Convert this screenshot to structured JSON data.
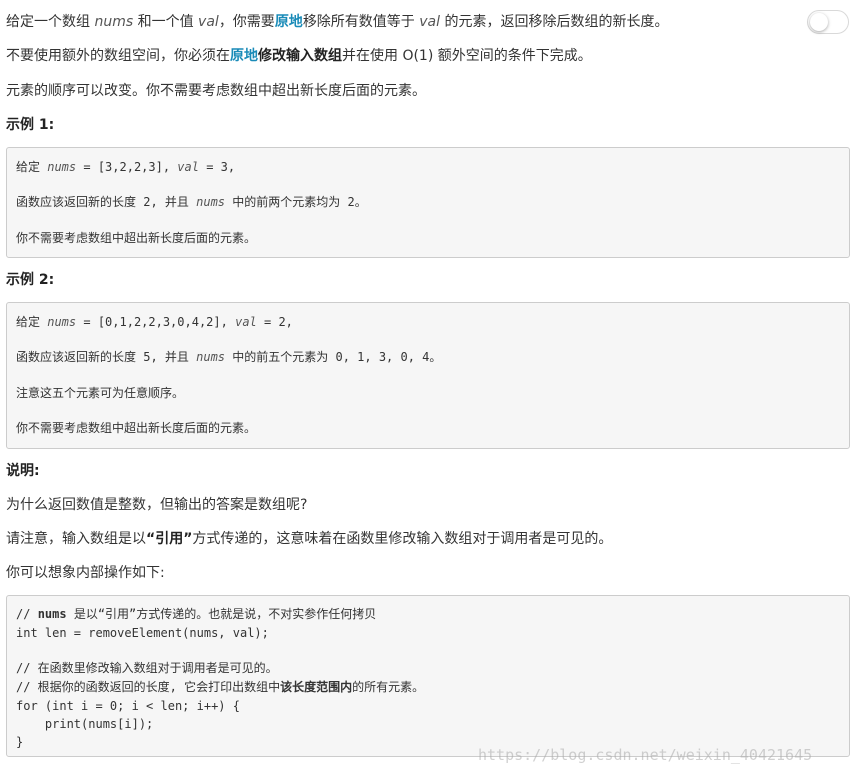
{
  "intro": {
    "p1": {
      "a": "给定一个数组 ",
      "nums": "nums",
      "b": " 和一个值 ",
      "val": "val",
      "c": "，你需要",
      "inplace": "原地",
      "d": "移除所有数值等于 ",
      "val2": "val",
      "e": " 的元素，返回移除后数组的新长度。"
    },
    "p2": {
      "a": "不要使用额外的数组空间，你必须在",
      "inplace": "原地",
      "modify": "修改输入数组",
      "b": "并在使用 O(1) 额外空间的条件下完成。"
    },
    "p3": "元素的顺序可以改变。你不需要考虑数组中超出新长度后面的元素。"
  },
  "example1": {
    "heading": "示例 1:",
    "line1": {
      "a": "给定 ",
      "nums": "nums",
      "b": " = [3,2,2,3], ",
      "val": "val",
      "c": " = 3,"
    },
    "line2": {
      "a": "函数应该返回新的长度 2, 并且 ",
      "nums": "nums",
      "b": " 中的前两个元素均为 2。"
    },
    "line3": "你不需要考虑数组中超出新长度后面的元素。"
  },
  "example2": {
    "heading": "示例 2:",
    "line1": {
      "a": "给定 ",
      "nums": "nums",
      "b": " = [0,1,2,2,3,0,4,2], ",
      "val": "val",
      "c": " = 2,"
    },
    "line2": {
      "a": "函数应该返回新的长度 5, 并且 ",
      "nums": "nums",
      "b": " 中的前五个元素为 0, 1, 3, 0, 4。"
    },
    "line3": "注意这五个元素可为任意顺序。",
    "line4": "你不需要考虑数组中超出新长度后面的元素。"
  },
  "explain": {
    "heading": "说明:",
    "p1": "为什么返回数值是整数，但输出的答案是数组呢?",
    "p2": {
      "a": "请注意，输入数组是以",
      "ref": "“引用”",
      "b": "方式传递的，这意味着在函数里修改输入数组对于调用者是可见的。"
    },
    "p3": "你可以想象内部操作如下:"
  },
  "code": {
    "c1": {
      "a": "// ",
      "nums": "nums",
      "b": " 是以“引用”方式传递的。也就是说，不对实参作任何拷贝"
    },
    "c2": "int len = removeElement(nums, val);",
    "c3": "// 在函数里修改输入数组对于调用者是可见的。",
    "c4": {
      "a": "// 根据你的函数返回的长度, 它会打印出数组中",
      "range": "该长度范围内",
      "b": "的所有元素。"
    },
    "c5": "for (int i = 0; i < len; i++) {",
    "c6": "    print(nums[i]);",
    "c7": "}"
  },
  "watermark": "https://blog.csdn.net/weixin_40421645"
}
